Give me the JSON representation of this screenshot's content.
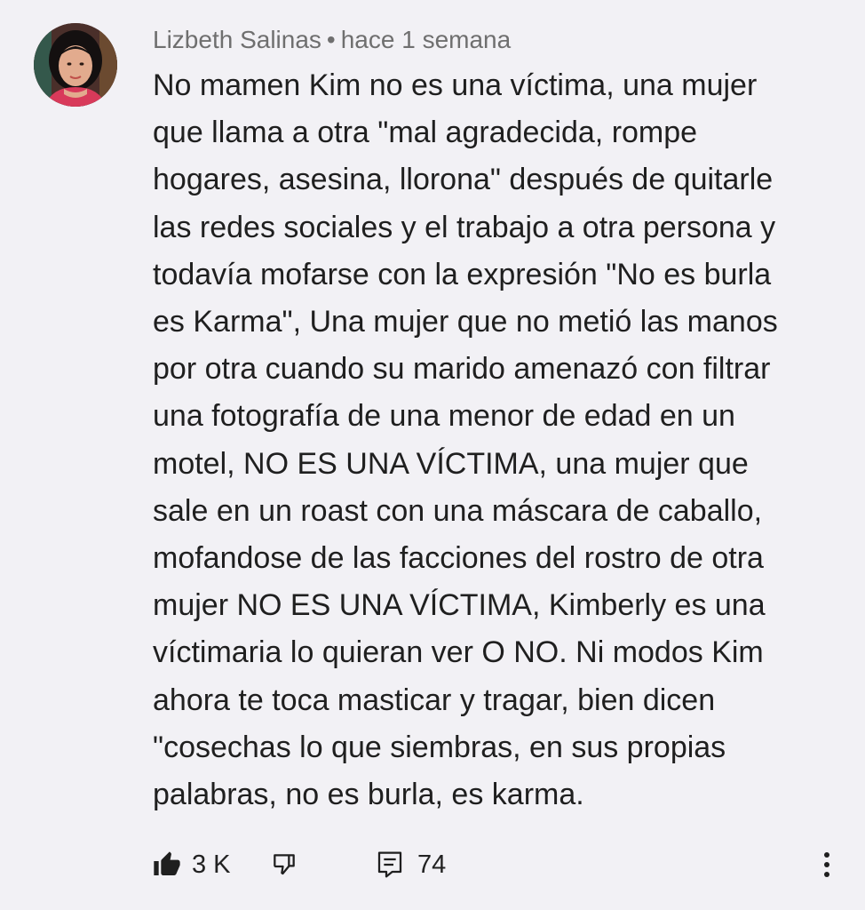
{
  "comment": {
    "author": "Lizbeth Salinas",
    "separator": "•",
    "timestamp": "hace 1 semana",
    "body_lines": [
      "No mamen Kim no es una víctima, una mujer",
      "que llama a otra \"mal agradecida, rompe",
      "hogares, asesina, llorona\" después de quitarle",
      "las redes sociales y el trabajo a otra persona y",
      "todavía mofarse con la expresión \"No es burla",
      "es Karma\", Una mujer que no metió las manos",
      "por otra cuando su marido amenazó con filtrar",
      "una fotografía de una menor de edad en un",
      "motel, NO ES UNA VÍCTIMA, una mujer que",
      "sale en un roast con una máscara de caballo,",
      "mofandose de las facciones del rostro de otra",
      "mujer NO ES UNA VÍCTIMA, Kimberly es una",
      "víctimaria lo quieran ver O NO. Ni modos Kim",
      "ahora te toca masticar y tragar, bien dicen",
      "\"cosechas lo que siembras, en sus propias",
      "palabras, no es burla, es karma."
    ],
    "likes": "3 K",
    "replies": "74"
  },
  "icons": {
    "like": "thumbs-up-filled-icon",
    "dislike": "thumbs-down-outline-icon",
    "replies": "comment-outline-icon",
    "more": "vertical-ellipsis-icon"
  },
  "colors": {
    "background": "#f2f1f5",
    "meta_text": "#6f6f6f",
    "body_text": "#1f1f1f"
  }
}
